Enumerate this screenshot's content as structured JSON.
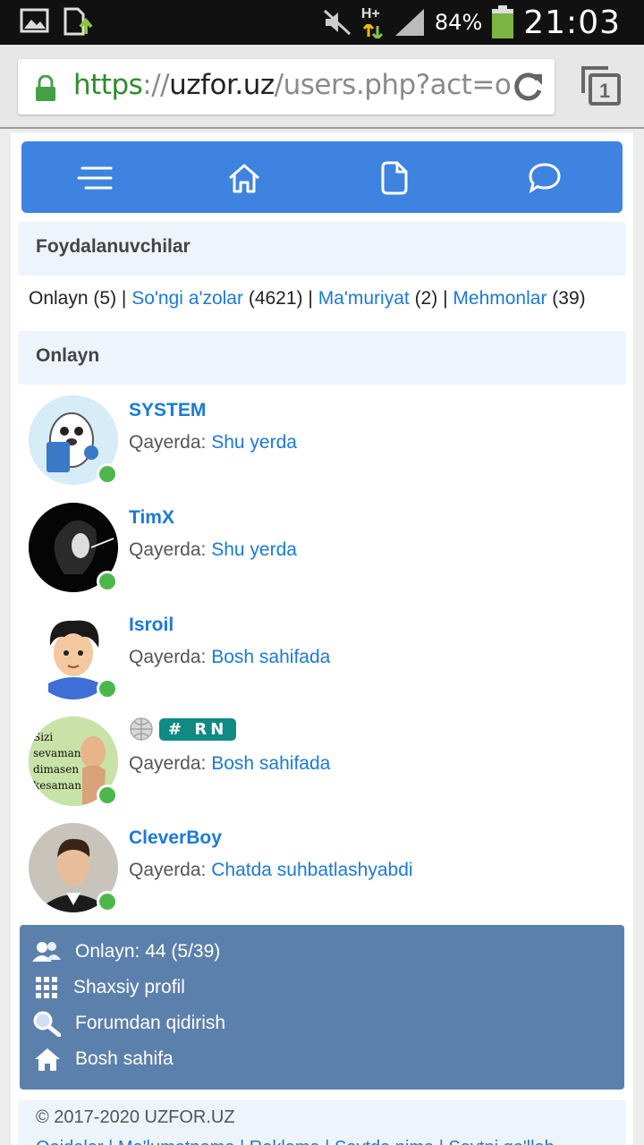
{
  "status_bar": {
    "left_icons": [
      "image-icon",
      "download-icon"
    ],
    "network": "H+",
    "battery": "84%",
    "time": "21:03"
  },
  "browser": {
    "url_scheme": "https",
    "url_sep": "://",
    "url_host": "uzfor.uz",
    "url_path": "/users.php?act=onli",
    "tab_count": "1"
  },
  "nav": {
    "icons": [
      "menu-icon",
      "home-icon",
      "document-icon",
      "chat-icon"
    ]
  },
  "header_title": "Foydalanuvchilar",
  "tabs": {
    "online_label": "Onlayn",
    "online_count": "(5)",
    "sep": "|",
    "new_members_label": "So'ngi a'zolar",
    "new_members_count": "(4621)",
    "admins_label": "Ma'muriyat",
    "admins_count": "(2)",
    "guests_label": "Mehmonlar",
    "guests_count": "(39)"
  },
  "online_title": "Onlayn",
  "location_label": "Qayerda:",
  "users": [
    {
      "name": "SYSTEM",
      "location": "Shu yerda"
    },
    {
      "name": "TimX",
      "location": "Shu yerda"
    },
    {
      "name": "Isroil",
      "location": "Bosh sahifada"
    },
    {
      "name": "",
      "badge": "# RN",
      "location": "Bosh sahifada",
      "avatar_text": [
        "Sizi",
        "sevaman",
        "dimasen",
        "kesaman"
      ]
    },
    {
      "name": "CleverBoy",
      "location": "Chatda suhbatlashyabdi"
    }
  ],
  "footer_menu": [
    {
      "label": "Onlayn: 44 (5/39)",
      "icon": "users-icon"
    },
    {
      "label": "Shaxsiy profil",
      "icon": "grid-icon"
    },
    {
      "label": "Forumdan qidirish",
      "icon": "search-icon"
    },
    {
      "label": "Bosh sahifa",
      "icon": "home-icon"
    }
  ],
  "copyright": "© 2017-2020 UZFOR.UZ",
  "copyright_links": "Qoidalar | Ma'lumotnoma | Reklama | Saytda nima | Saytni qo'llab"
}
